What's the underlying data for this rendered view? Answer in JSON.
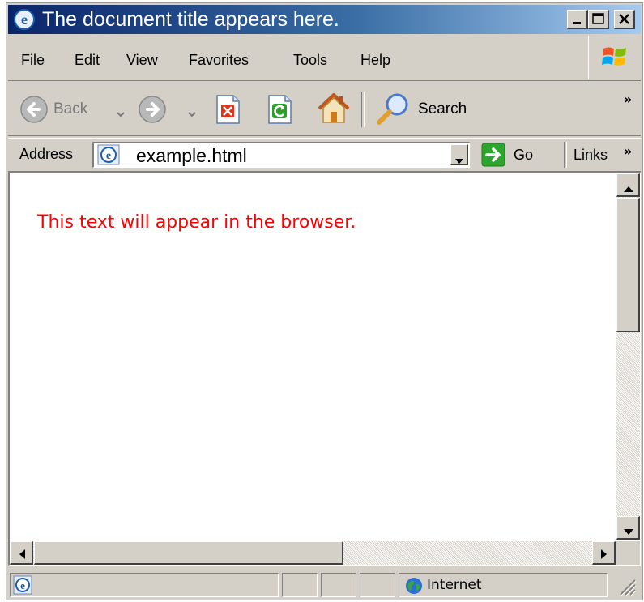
{
  "window": {
    "title": "The document title appears here."
  },
  "menu": {
    "items": [
      "File",
      "Edit",
      "View",
      "Favorites",
      "Tools",
      "Help"
    ]
  },
  "toolbar": {
    "back_label": "Back",
    "search_label": "Search",
    "overflow_label": "»"
  },
  "address_bar": {
    "label": "Address",
    "value": "example.html",
    "go_label": "Go",
    "links_label": "Links",
    "links_overflow": "»"
  },
  "page": {
    "text": "This text will appear in the browser.",
    "text_color": "#ff0000"
  },
  "status_bar": {
    "zone": "Internet"
  },
  "colors": {
    "titlebar_start": "#0a246a",
    "titlebar_end": "#a6caf0",
    "chrome": "#d4d0c8"
  }
}
